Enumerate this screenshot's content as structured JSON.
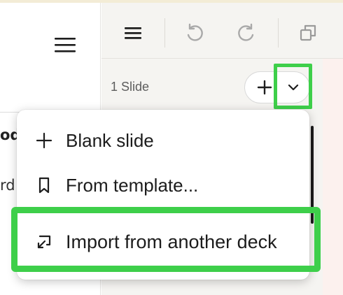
{
  "toolbar": {
    "menu_icon": "hamburger-icon",
    "undo_icon": "undo-icon",
    "redo_icon": "redo-icon",
    "duplicate_icon": "duplicate-icon"
  },
  "left_panel": {
    "menu_icon": "hamburger-icon",
    "truncated_text_1": "od",
    "truncated_text_2": "rd"
  },
  "slides": {
    "count_label": "1 Slide",
    "add_icon": "plus-icon",
    "dropdown_icon": "chevron-down-icon"
  },
  "menu": {
    "items": [
      {
        "label": "Blank slide",
        "icon": "plus-icon"
      },
      {
        "label": "From template...",
        "icon": "bookmark-icon"
      },
      {
        "label": "Import from another deck",
        "icon": "import-icon"
      }
    ]
  },
  "colors": {
    "highlight": "#3ecf4a",
    "panel_bg": "#f5f4f1",
    "right_strip": "#fcf1ee"
  }
}
